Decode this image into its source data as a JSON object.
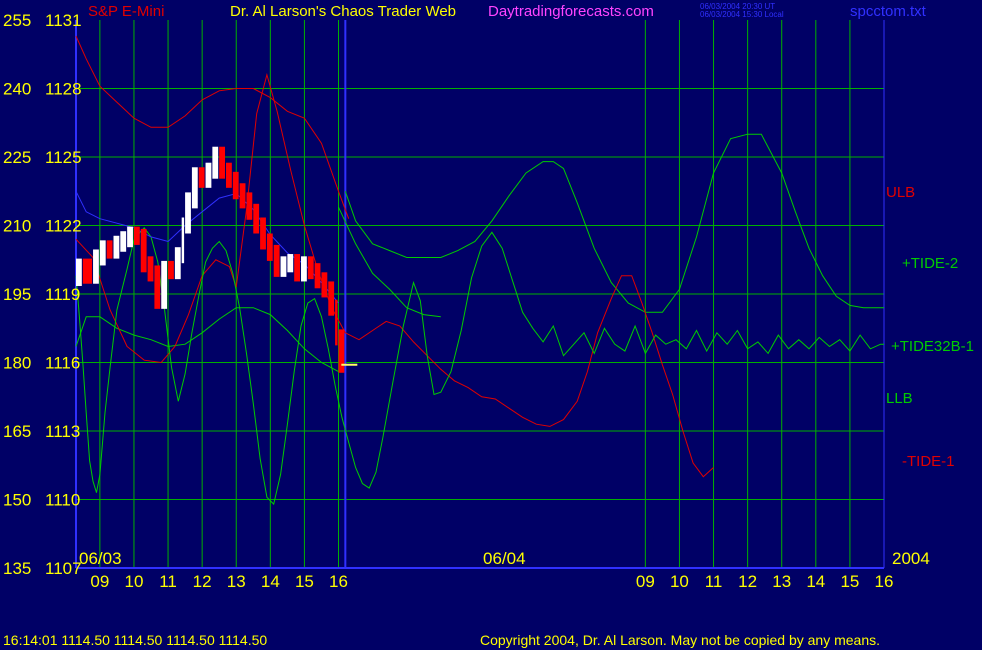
{
  "header": {
    "instrument": "S&P E-Mini",
    "title": "Dr. Al Larson's Chaos Trader Web",
    "site": "Daytradingforecasts.com",
    "time_ut": "06/03/2004 20:30 UT",
    "time_local": "06/03/2004 15:30 Local",
    "filename": "spcctom.txt"
  },
  "footer": {
    "quote": "16:14:01  1114.50 1114.50 1114.50 1114.50",
    "copyright": "Copyright 2004, Dr. Al Larson. May not be copied by any means."
  },
  "colors": {
    "background": "#000066",
    "grid": "#00b000",
    "axis": "#3030ff",
    "labels": "#ffff00",
    "ulb": "#e00000",
    "llb": "#00cc00",
    "tide2": "#00cc00",
    "tide32b1": "#00cc00",
    "minus_tide1": "#e00000",
    "price_up": "#ffffff",
    "price_down": "#ff0000",
    "avg": "#3030ff"
  },
  "chart_data": {
    "type": "line",
    "title": "Dr. Al Larson's Chaos Trader Web",
    "left_axis_labels": [
      "255",
      "240",
      "225",
      "210",
      "195",
      "180",
      "165",
      "150",
      "135"
    ],
    "right_axis_labels": [
      "1131",
      "1128",
      "1125",
      "1122",
      "1119",
      "1116",
      "1113",
      "1110",
      "1107"
    ],
    "ylim": [
      1107,
      1131
    ],
    "x_ticks": [
      "09",
      "10",
      "11",
      "12",
      "13",
      "14",
      "15",
      "16",
      "09",
      "10",
      "11",
      "12",
      "13",
      "14",
      "15",
      "16"
    ],
    "x_hours": [
      9,
      10,
      11,
      12,
      13,
      14,
      15,
      16,
      25,
      26,
      27,
      28,
      29,
      30,
      31,
      32
    ],
    "xlim": [
      8.3,
      32
    ],
    "day_markers": [
      {
        "label": "06/03",
        "x": 8.3
      },
      {
        "label": "06/04",
        "x": 16.2
      }
    ],
    "year_label": "2004",
    "series_labels": [
      "ULB",
      "+TIDE-2",
      "+TIDE32B-1",
      "LLB",
      "-TIDE-1"
    ],
    "series": [
      {
        "name": "ULB",
        "color": "#e00000",
        "points": [
          [
            8.3,
            1130.3
          ],
          [
            8.6,
            1129.3
          ],
          [
            9.0,
            1128.1
          ],
          [
            9.5,
            1127.4
          ],
          [
            10.0,
            1126.7
          ],
          [
            10.5,
            1126.3
          ],
          [
            11.0,
            1126.3
          ],
          [
            11.5,
            1126.8
          ],
          [
            12.0,
            1127.5
          ],
          [
            12.5,
            1127.9
          ],
          [
            13.0,
            1128.0
          ],
          [
            13.5,
            1128.0
          ],
          [
            14.0,
            1127.6
          ],
          [
            14.5,
            1127.0
          ],
          [
            15.0,
            1126.7
          ],
          [
            15.5,
            1125.6
          ],
          [
            16.0,
            1123.5
          ],
          [
            16.3,
            1122.3
          ]
        ]
      },
      {
        "name": "LLB",
        "color": "#00cc00",
        "points": [
          [
            8.3,
            1116.7
          ],
          [
            8.6,
            1118.0
          ],
          [
            9.0,
            1118.0
          ],
          [
            9.5,
            1117.5
          ],
          [
            10.0,
            1117.2
          ],
          [
            10.5,
            1117.0
          ],
          [
            11.0,
            1116.7
          ],
          [
            11.5,
            1116.8
          ],
          [
            12.0,
            1117.3
          ],
          [
            12.5,
            1117.9
          ],
          [
            13.0,
            1118.4
          ],
          [
            13.5,
            1118.4
          ],
          [
            14.0,
            1118.1
          ],
          [
            14.5,
            1117.4
          ],
          [
            15.0,
            1116.6
          ],
          [
            15.5,
            1116.0
          ],
          [
            16.0,
            1115.6
          ]
        ]
      },
      {
        "name": "+TIDE-2",
        "color": "#00cc00",
        "points": [
          [
            16.0,
            1122.8
          ],
          [
            16.5,
            1121.2
          ],
          [
            17.0,
            1119.9
          ],
          [
            17.5,
            1119.2
          ],
          [
            18.0,
            1118.4
          ],
          [
            18.5,
            1118.1
          ],
          [
            19.0,
            1118.0
          ]
        ]
      },
      {
        "name": "+TIDE-2 (06/04)",
        "color": "#00cc00",
        "points": [
          [
            16.2,
            1123.5
          ],
          [
            16.5,
            1122.2
          ],
          [
            17.0,
            1121.2
          ],
          [
            17.5,
            1120.9
          ],
          [
            18.0,
            1120.6
          ],
          [
            18.6,
            1120.6
          ],
          [
            19.0,
            1120.6
          ],
          [
            19.5,
            1120.9
          ],
          [
            20.0,
            1121.3
          ],
          [
            20.5,
            1122.2
          ],
          [
            21.0,
            1123.3
          ],
          [
            21.5,
            1124.3
          ],
          [
            22.0,
            1124.8
          ],
          [
            22.3,
            1124.8
          ],
          [
            22.6,
            1124.5
          ],
          [
            23.0,
            1123.0
          ],
          [
            23.5,
            1121.0
          ],
          [
            24.0,
            1119.5
          ],
          [
            24.5,
            1118.6
          ],
          [
            25.0,
            1118.2
          ],
          [
            25.5,
            1118.2
          ],
          [
            26.0,
            1119.2
          ],
          [
            26.5,
            1121.5
          ],
          [
            27.0,
            1124.3
          ],
          [
            27.5,
            1125.8
          ],
          [
            28.0,
            1126.0
          ],
          [
            28.4,
            1126.0
          ],
          [
            29.0,
            1124.3
          ],
          [
            29.4,
            1122.6
          ],
          [
            29.8,
            1121.0
          ],
          [
            30.2,
            1119.8
          ],
          [
            30.6,
            1118.9
          ],
          [
            31.0,
            1118.5
          ],
          [
            31.4,
            1118.4
          ],
          [
            31.7,
            1118.4
          ],
          [
            32.0,
            1118.4
          ]
        ]
      },
      {
        "name": "-TIDE-1",
        "color": "#e00000",
        "points": [
          [
            8.3,
            1121.4
          ],
          [
            8.8,
            1120.6
          ],
          [
            9.3,
            1118.3
          ],
          [
            9.8,
            1116.7
          ],
          [
            10.3,
            1116.1
          ],
          [
            10.8,
            1116.0
          ],
          [
            11.2,
            1116.7
          ],
          [
            11.6,
            1118.1
          ],
          [
            12.0,
            1119.8
          ],
          [
            12.4,
            1120.5
          ],
          [
            12.8,
            1120.2
          ],
          [
            13.0,
            1119.3
          ],
          [
            13.3,
            1122.7
          ],
          [
            13.6,
            1126.9
          ],
          [
            13.9,
            1128.6
          ],
          [
            14.2,
            1127.0
          ],
          [
            14.6,
            1124.4
          ],
          [
            15.0,
            1122.0
          ],
          [
            15.4,
            1120.0
          ],
          [
            15.8,
            1118.4
          ],
          [
            16.2,
            1117.3
          ],
          [
            16.6,
            1117.0
          ],
          [
            17.0,
            1117.4
          ],
          [
            17.4,
            1117.8
          ],
          [
            17.8,
            1117.6
          ],
          [
            18.2,
            1116.9
          ],
          [
            18.6,
            1116.3
          ],
          [
            19.0,
            1115.7
          ],
          [
            19.4,
            1115.2
          ],
          [
            19.8,
            1114.9
          ],
          [
            20.2,
            1114.5
          ],
          [
            20.6,
            1114.4
          ],
          [
            21.0,
            1114.0
          ],
          [
            21.4,
            1113.6
          ],
          [
            21.8,
            1113.3
          ],
          [
            22.2,
            1113.2
          ],
          [
            22.6,
            1113.5
          ],
          [
            23.0,
            1114.3
          ],
          [
            23.3,
            1115.6
          ],
          [
            23.6,
            1117.3
          ],
          [
            24.0,
            1118.8
          ],
          [
            24.3,
            1119.8
          ],
          [
            24.6,
            1119.8
          ],
          [
            24.9,
            1118.6
          ],
          [
            25.2,
            1117.3
          ],
          [
            25.5,
            1115.9
          ],
          [
            25.8,
            1114.6
          ],
          [
            26.1,
            1113.0
          ],
          [
            26.4,
            1111.6
          ],
          [
            26.7,
            1111.0
          ],
          [
            27.0,
            1111.4
          ]
        ]
      },
      {
        "name": "+TIDE32B-1",
        "color": "#00cc00",
        "points": [
          [
            8.3,
            1119.8
          ],
          [
            8.4,
            1118.0
          ],
          [
            8.5,
            1116.0
          ],
          [
            8.6,
            1113.8
          ],
          [
            8.7,
            1111.7
          ],
          [
            8.8,
            1110.8
          ],
          [
            8.9,
            1110.3
          ],
          [
            9.0,
            1111.1
          ],
          [
            9.15,
            1113.8
          ],
          [
            9.3,
            1115.8
          ],
          [
            9.5,
            1118.3
          ],
          [
            9.8,
            1120.1
          ],
          [
            10.0,
            1121.4
          ],
          [
            10.3,
            1121.9
          ],
          [
            10.5,
            1121.5
          ],
          [
            10.7,
            1120.4
          ],
          [
            10.9,
            1118.3
          ],
          [
            11.1,
            1115.8
          ],
          [
            11.3,
            1114.3
          ],
          [
            11.5,
            1115.5
          ],
          [
            11.7,
            1117.3
          ],
          [
            11.9,
            1118.9
          ],
          [
            12.1,
            1120.4
          ],
          [
            12.3,
            1121.0
          ],
          [
            12.5,
            1121.3
          ],
          [
            12.7,
            1120.9
          ],
          [
            12.9,
            1119.9
          ],
          [
            13.1,
            1118.4
          ],
          [
            13.3,
            1116.4
          ],
          [
            13.5,
            1114.2
          ],
          [
            13.7,
            1111.8
          ],
          [
            13.9,
            1110.1
          ],
          [
            14.1,
            1109.8
          ],
          [
            14.3,
            1111.1
          ],
          [
            14.5,
            1113.3
          ],
          [
            14.7,
            1115.6
          ],
          [
            14.9,
            1117.6
          ],
          [
            15.1,
            1118.6
          ],
          [
            15.3,
            1118.8
          ],
          [
            15.5,
            1118.0
          ],
          [
            15.7,
            1116.6
          ],
          [
            15.9,
            1115.0
          ],
          [
            16.1,
            1113.6
          ],
          [
            16.3,
            1112.5
          ],
          [
            16.5,
            1111.4
          ],
          [
            16.7,
            1110.7
          ],
          [
            16.9,
            1110.5
          ],
          [
            17.1,
            1111.2
          ],
          [
            17.3,
            1112.7
          ],
          [
            17.6,
            1115.2
          ],
          [
            17.9,
            1117.6
          ],
          [
            18.2,
            1119.5
          ],
          [
            18.4,
            1118.7
          ],
          [
            18.6,
            1116.3
          ],
          [
            18.8,
            1114.6
          ],
          [
            19.0,
            1114.7
          ],
          [
            19.3,
            1115.6
          ],
          [
            19.6,
            1117.4
          ],
          [
            19.9,
            1119.7
          ],
          [
            20.2,
            1121.1
          ],
          [
            20.5,
            1121.7
          ],
          [
            20.8,
            1121.0
          ],
          [
            21.1,
            1119.6
          ],
          [
            21.4,
            1118.2
          ],
          [
            21.7,
            1117.5
          ],
          [
            22.0,
            1116.9
          ],
          [
            22.3,
            1117.6
          ],
          [
            22.6,
            1116.3
          ],
          [
            22.9,
            1116.8
          ],
          [
            23.2,
            1117.3
          ],
          [
            23.5,
            1116.4
          ],
          [
            23.8,
            1117.5
          ],
          [
            24.1,
            1116.8
          ],
          [
            24.4,
            1116.5
          ],
          [
            24.7,
            1117.6
          ],
          [
            25.0,
            1116.4
          ],
          [
            25.3,
            1117.2
          ],
          [
            25.6,
            1116.8
          ],
          [
            25.9,
            1117.0
          ],
          [
            26.2,
            1116.6
          ],
          [
            26.5,
            1117.4
          ],
          [
            26.8,
            1116.5
          ],
          [
            27.1,
            1117.3
          ],
          [
            27.4,
            1116.8
          ],
          [
            27.7,
            1117.4
          ],
          [
            28.0,
            1116.6
          ],
          [
            28.3,
            1116.9
          ],
          [
            28.6,
            1116.4
          ],
          [
            28.9,
            1117.2
          ],
          [
            29.2,
            1116.6
          ],
          [
            29.5,
            1117.0
          ],
          [
            29.8,
            1116.6
          ],
          [
            30.1,
            1117.1
          ],
          [
            30.4,
            1116.7
          ],
          [
            30.7,
            1117.0
          ],
          [
            31.0,
            1116.5
          ],
          [
            31.3,
            1117.2
          ],
          [
            31.6,
            1116.6
          ],
          [
            31.9,
            1116.8
          ],
          [
            32.0,
            1116.8
          ]
        ]
      },
      {
        "name": "price-avg",
        "color": "#3030ff",
        "points": [
          [
            8.3,
            1123.5
          ],
          [
            8.6,
            1122.6
          ],
          [
            9.0,
            1122.3
          ],
          [
            9.5,
            1122.1
          ],
          [
            10.0,
            1121.9
          ],
          [
            10.5,
            1121.5
          ],
          [
            11.0,
            1121.3
          ],
          [
            11.5,
            1122.0
          ],
          [
            12.0,
            1122.6
          ],
          [
            12.5,
            1123.2
          ],
          [
            13.0,
            1123.4
          ],
          [
            13.5,
            1122.7
          ],
          [
            14.0,
            1121.6
          ],
          [
            14.5,
            1120.8
          ],
          [
            15.0,
            1120.3
          ],
          [
            15.5,
            1119.5
          ],
          [
            16.0,
            1118.6
          ]
        ]
      }
    ],
    "price": [
      [
        8.3,
        1119.7
      ],
      [
        8.5,
        1120.2
      ],
      [
        8.8,
        1119.8
      ],
      [
        9.0,
        1120.6
      ],
      [
        9.2,
        1121.0
      ],
      [
        9.4,
        1120.9
      ],
      [
        9.6,
        1121.2
      ],
      [
        9.8,
        1121.4
      ],
      [
        10.0,
        1121.6
      ],
      [
        10.2,
        1121.5
      ],
      [
        10.4,
        1120.3
      ],
      [
        10.6,
        1119.9
      ],
      [
        10.8,
        1118.7
      ],
      [
        11.0,
        1120.1
      ],
      [
        11.2,
        1120.0
      ],
      [
        11.4,
        1120.7
      ],
      [
        11.5,
        1122.0
      ],
      [
        11.7,
        1123.1
      ],
      [
        11.9,
        1124.2
      ],
      [
        12.1,
        1124.0
      ],
      [
        12.3,
        1124.4
      ],
      [
        12.5,
        1125.1
      ],
      [
        12.7,
        1124.4
      ],
      [
        12.9,
        1124.0
      ],
      [
        13.1,
        1123.5
      ],
      [
        13.3,
        1123.1
      ],
      [
        13.5,
        1122.6
      ],
      [
        13.7,
        1122.0
      ],
      [
        13.9,
        1121.3
      ],
      [
        14.1,
        1120.8
      ],
      [
        14.3,
        1120.1
      ],
      [
        14.5,
        1120.3
      ],
      [
        14.7,
        1120.4
      ],
      [
        14.9,
        1119.9
      ],
      [
        15.1,
        1120.3
      ],
      [
        15.3,
        1120.0
      ],
      [
        15.5,
        1119.6
      ],
      [
        15.7,
        1119.2
      ],
      [
        15.9,
        1118.4
      ],
      [
        16.0,
        1117.1
      ],
      [
        16.2,
        1115.9
      ]
    ]
  }
}
